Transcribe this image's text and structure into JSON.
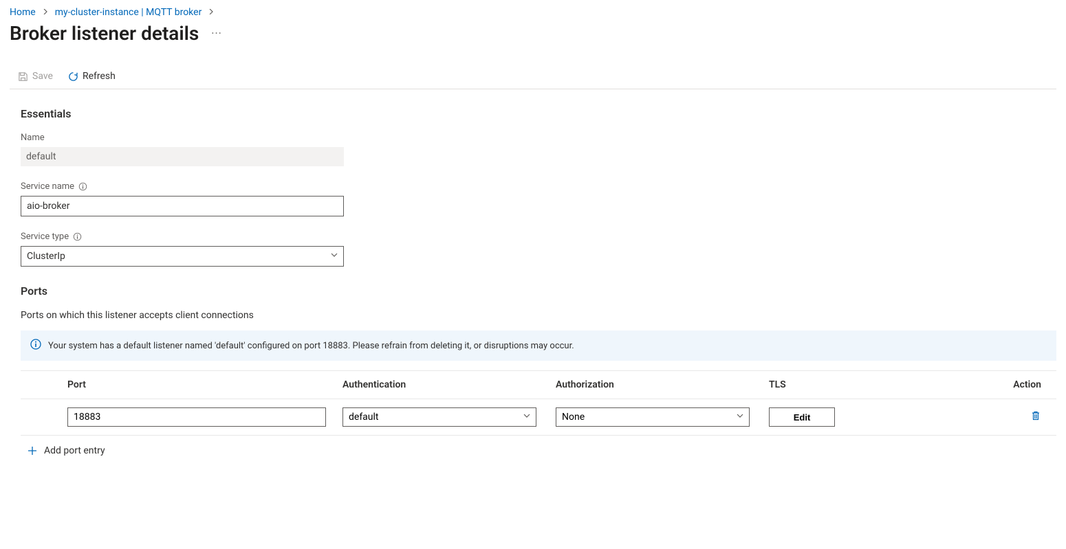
{
  "breadcrumb": {
    "home": "Home",
    "cluster": "my-cluster-instance | MQTT broker"
  },
  "page": {
    "title": "Broker listener details"
  },
  "toolbar": {
    "save": "Save",
    "refresh": "Refresh"
  },
  "essentials": {
    "heading": "Essentials",
    "name_label": "Name",
    "name_value": "default",
    "service_name_label": "Service name",
    "service_name_value": "aio-broker",
    "service_type_label": "Service type",
    "service_type_value": "ClusterIp"
  },
  "ports": {
    "heading": "Ports",
    "description": "Ports on which this listener accepts client connections",
    "banner": "Your system has a default listener named 'default' configured on port 18883. Please refrain from deleting it, or disruptions may occur.",
    "columns": {
      "port": "Port",
      "authn": "Authentication",
      "authz": "Authorization",
      "tls": "TLS",
      "action": "Action"
    },
    "rows": [
      {
        "port": "18883",
        "authn": "default",
        "authz": "None",
        "tls_label": "Edit"
      }
    ],
    "add_label": "Add port entry"
  }
}
